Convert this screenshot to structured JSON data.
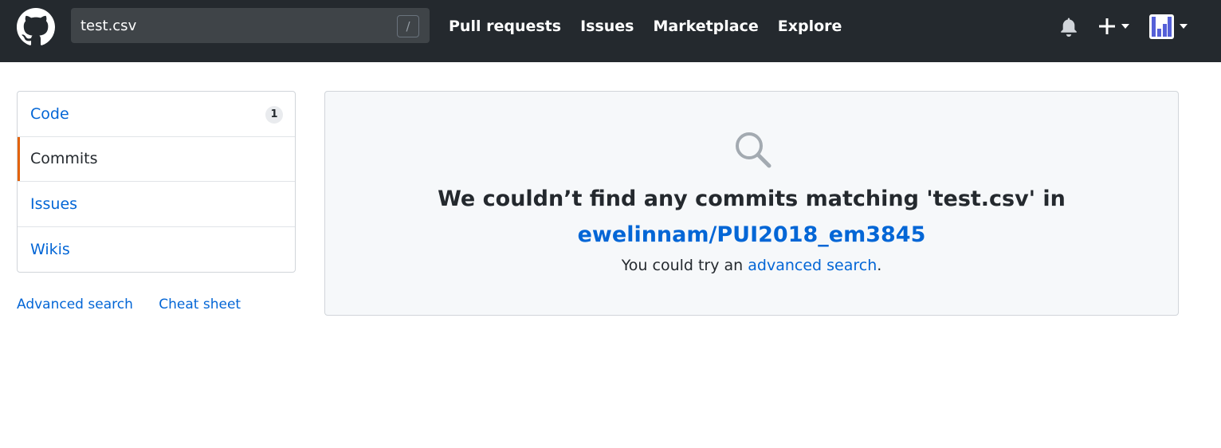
{
  "header": {
    "logo_icon": "github-mark-icon",
    "search": {
      "value": "test.csv",
      "shortcut_key": "/"
    },
    "nav": [
      {
        "label": "Pull requests"
      },
      {
        "label": "Issues"
      },
      {
        "label": "Marketplace"
      },
      {
        "label": "Explore"
      }
    ],
    "right_icons": [
      "bell-icon",
      "plus-icon",
      "avatar"
    ],
    "background_color": "#24292e"
  },
  "sidebar": {
    "items": [
      {
        "label": "Code",
        "count": "1",
        "selected": false
      },
      {
        "label": "Commits",
        "selected": true
      },
      {
        "label": "Issues",
        "selected": false
      },
      {
        "label": "Wikis",
        "selected": false
      }
    ],
    "links": [
      {
        "label": "Advanced search"
      },
      {
        "label": "Cheat sheet"
      }
    ],
    "selected_accent_color": "#e36209"
  },
  "blankslate": {
    "icon": "search-icon",
    "title": "We couldn’t find any commits matching 'test.csv' in",
    "repo": "ewelinnam/PUI2018_em3845",
    "hint_prefix": "You could try an ",
    "hint_link": "advanced search",
    "hint_suffix": "."
  },
  "colors": {
    "link": "#0366d6",
    "text": "#24292e",
    "panel_background": "#f6f8fa"
  }
}
